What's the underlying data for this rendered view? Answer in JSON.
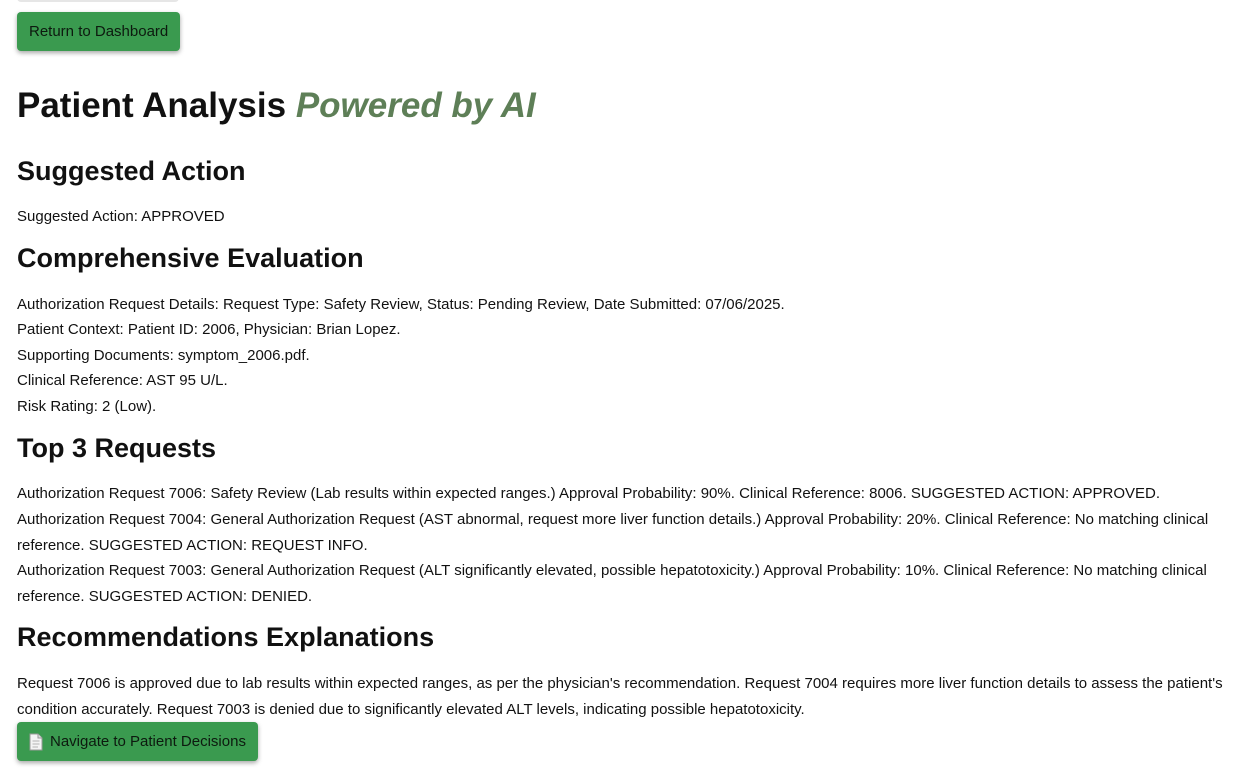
{
  "buttons": {
    "return_label": "Return to Dashboard",
    "navigate_label": "Navigate to Patient Decisions"
  },
  "title": {
    "main": "Patient Analysis",
    "accent": "Powered by AI"
  },
  "suggested_action": {
    "heading": "Suggested Action",
    "text": "Suggested Action: APPROVED"
  },
  "evaluation": {
    "heading": "Comprehensive Evaluation",
    "lines": [
      "Authorization Request Details: Request Type: Safety Review, Status: Pending Review, Date Submitted: 07/06/2025.",
      "Patient Context: Patient ID: 2006, Physician: Brian Lopez.",
      "Supporting Documents: symptom_2006.pdf.",
      "Clinical Reference: AST 95 U/L.",
      "Risk Rating: 2 (Low)."
    ]
  },
  "requests": {
    "heading": "Top 3 Requests",
    "items": [
      "Authorization Request 7006: Safety Review (Lab results within expected ranges.) Approval Probability: 90%. Clinical Reference: 8006. SUGGESTED ACTION: APPROVED.",
      "Authorization Request 7004: General Authorization Request (AST abnormal, request more liver function details.) Approval Probability: 20%. Clinical Reference: No matching clinical reference. SUGGESTED ACTION: REQUEST INFO.",
      "Authorization Request 7003: General Authorization Request (ALT significantly elevated, possible hepatotoxicity.) Approval Probability: 10%. Clinical Reference: No matching clinical reference. SUGGESTED ACTION: DENIED."
    ]
  },
  "recommendations": {
    "heading": "Recommendations Explanations",
    "text": "Request 7006 is approved due to lab results within expected ranges, as per the physician's recommendation. Request 7004 requires more liver function details to assess the patient's condition accurately. Request 7003 is denied due to significantly elevated ALT levels, indicating possible hepatotoxicity."
  },
  "icons": {
    "navigate_icon": "document-icon"
  },
  "colors": {
    "button_bg": "#3a9a4f",
    "accent_text": "#5e7f57"
  }
}
